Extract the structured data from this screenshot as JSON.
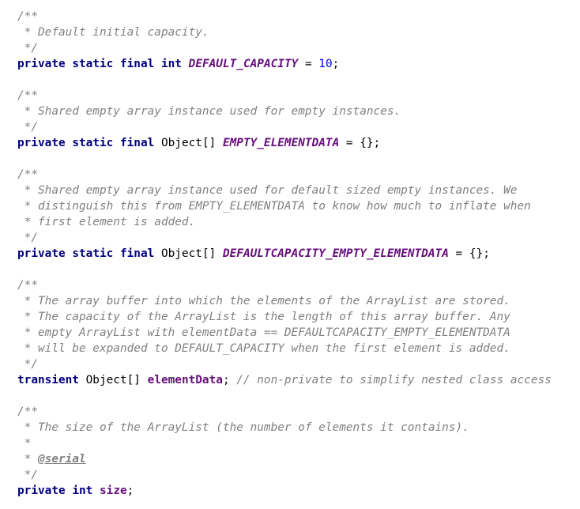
{
  "lines": [
    [
      {
        "t": "/**",
        "k": "comment"
      }
    ],
    [
      {
        "t": " * Default initial capacity.",
        "k": "comment"
      }
    ],
    [
      {
        "t": " */",
        "k": "comment"
      }
    ],
    [
      {
        "t": "private",
        "k": "keyword"
      },
      {
        "t": " ",
        "k": "plain"
      },
      {
        "t": "static",
        "k": "keyword"
      },
      {
        "t": " ",
        "k": "plain"
      },
      {
        "t": "final",
        "k": "keyword"
      },
      {
        "t": " ",
        "k": "plain"
      },
      {
        "t": "int",
        "k": "keyword"
      },
      {
        "t": " ",
        "k": "plain"
      },
      {
        "t": "DEFAULT_CAPACITY",
        "k": "field-static"
      },
      {
        "t": " = ",
        "k": "plain"
      },
      {
        "t": "10",
        "k": "number"
      },
      {
        "t": ";",
        "k": "plain"
      }
    ],
    [],
    [
      {
        "t": "/**",
        "k": "comment"
      }
    ],
    [
      {
        "t": " * Shared empty array instance used for empty instances.",
        "k": "comment"
      }
    ],
    [
      {
        "t": " */",
        "k": "comment"
      }
    ],
    [
      {
        "t": "private",
        "k": "keyword"
      },
      {
        "t": " ",
        "k": "plain"
      },
      {
        "t": "static",
        "k": "keyword"
      },
      {
        "t": " ",
        "k": "plain"
      },
      {
        "t": "final",
        "k": "keyword"
      },
      {
        "t": " Object[] ",
        "k": "plain"
      },
      {
        "t": "EMPTY_ELEMENTDATA",
        "k": "field-static"
      },
      {
        "t": " = {};",
        "k": "plain"
      }
    ],
    [],
    [
      {
        "t": "/**",
        "k": "comment"
      }
    ],
    [
      {
        "t": " * Shared empty array instance used for default sized empty instances. We",
        "k": "comment"
      }
    ],
    [
      {
        "t": " * distinguish this from EMPTY_ELEMENTDATA to know how much to inflate when",
        "k": "comment"
      }
    ],
    [
      {
        "t": " * first element is added.",
        "k": "comment"
      }
    ],
    [
      {
        "t": " */",
        "k": "comment"
      }
    ],
    [
      {
        "t": "private",
        "k": "keyword"
      },
      {
        "t": " ",
        "k": "plain"
      },
      {
        "t": "static",
        "k": "keyword"
      },
      {
        "t": " ",
        "k": "plain"
      },
      {
        "t": "final",
        "k": "keyword"
      },
      {
        "t": " Object[] ",
        "k": "plain"
      },
      {
        "t": "DEFAULTCAPACITY_EMPTY_ELEMENTDATA",
        "k": "field-static"
      },
      {
        "t": " = {};",
        "k": "plain"
      }
    ],
    [],
    [
      {
        "t": "/**",
        "k": "comment"
      }
    ],
    [
      {
        "t": " * The array buffer into which the elements of the ArrayList are stored.",
        "k": "comment"
      }
    ],
    [
      {
        "t": " * The capacity of the ArrayList is the length of this array buffer. Any",
        "k": "comment"
      }
    ],
    [
      {
        "t": " * empty ArrayList with elementData == DEFAULTCAPACITY_EMPTY_ELEMENTDATA",
        "k": "comment"
      }
    ],
    [
      {
        "t": " * will be expanded to DEFAULT_CAPACITY when the first element is added.",
        "k": "comment"
      }
    ],
    [
      {
        "t": " */",
        "k": "comment"
      }
    ],
    [
      {
        "t": "transient",
        "k": "keyword"
      },
      {
        "t": " Object[] ",
        "k": "plain"
      },
      {
        "t": "elementData",
        "k": "field"
      },
      {
        "t": "; ",
        "k": "plain"
      },
      {
        "t": "// non-private to simplify nested class access",
        "k": "comment"
      }
    ],
    [],
    [
      {
        "t": "/**",
        "k": "comment"
      }
    ],
    [
      {
        "t": " * The size of the ArrayList (the number of elements it contains).",
        "k": "comment"
      }
    ],
    [
      {
        "t": " *",
        "k": "comment"
      }
    ],
    [
      {
        "t": " * ",
        "k": "comment"
      },
      {
        "t": "@serial",
        "k": "tag"
      }
    ],
    [
      {
        "t": " */",
        "k": "comment"
      }
    ],
    [
      {
        "t": "private",
        "k": "keyword"
      },
      {
        "t": " ",
        "k": "plain"
      },
      {
        "t": "int",
        "k": "keyword"
      },
      {
        "t": " ",
        "k": "plain"
      },
      {
        "t": "size",
        "k": "field"
      },
      {
        "t": ";",
        "k": "plain"
      }
    ]
  ]
}
